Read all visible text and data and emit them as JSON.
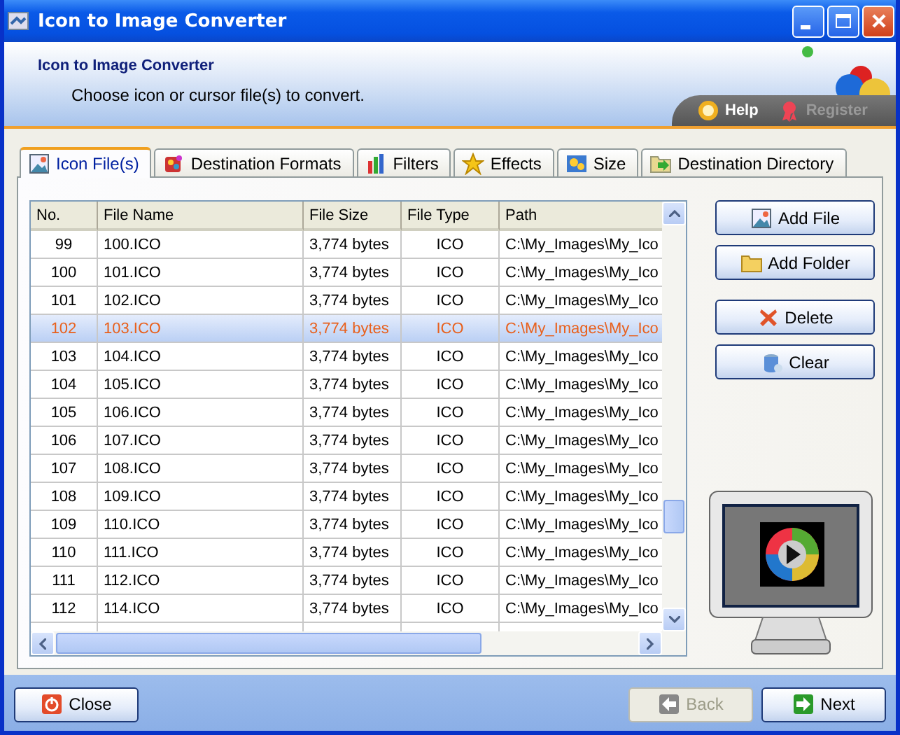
{
  "window": {
    "title": "Icon to Image Converter"
  },
  "header": {
    "title": "Icon to Image Converter",
    "subtitle": "Choose icon or cursor file(s) to convert.",
    "links": [
      {
        "label": "Help",
        "disabled": false
      },
      {
        "label": "Register",
        "disabled": true
      }
    ]
  },
  "tabs": [
    {
      "label": "Icon File(s)",
      "selected": true
    },
    {
      "label": "Destination Formats",
      "selected": false
    },
    {
      "label": "Filters",
      "selected": false
    },
    {
      "label": "Effects",
      "selected": false
    },
    {
      "label": "Size",
      "selected": false
    },
    {
      "label": "Destination Directory",
      "selected": false
    }
  ],
  "table": {
    "columns": [
      "No.",
      "File Name",
      "File Size",
      "File Type",
      "Path"
    ],
    "rows": [
      {
        "cells": [
          "99",
          "100.ICO",
          "3,774 bytes",
          "ICO",
          "C:\\My_Images\\My_Ico"
        ],
        "selected": false
      },
      {
        "cells": [
          "100",
          "101.ICO",
          "3,774 bytes",
          "ICO",
          "C:\\My_Images\\My_Ico"
        ],
        "selected": false
      },
      {
        "cells": [
          "101",
          "102.ICO",
          "3,774 bytes",
          "ICO",
          "C:\\My_Images\\My_Ico"
        ],
        "selected": false
      },
      {
        "cells": [
          "102",
          "103.ICO",
          "3,774 bytes",
          "ICO",
          "C:\\My_Images\\My_Ico"
        ],
        "selected": true
      },
      {
        "cells": [
          "103",
          "104.ICO",
          "3,774 bytes",
          "ICO",
          "C:\\My_Images\\My_Ico"
        ],
        "selected": false
      },
      {
        "cells": [
          "104",
          "105.ICO",
          "3,774 bytes",
          "ICO",
          "C:\\My_Images\\My_Ico"
        ],
        "selected": false
      },
      {
        "cells": [
          "105",
          "106.ICO",
          "3,774 bytes",
          "ICO",
          "C:\\My_Images\\My_Ico"
        ],
        "selected": false
      },
      {
        "cells": [
          "106",
          "107.ICO",
          "3,774 bytes",
          "ICO",
          "C:\\My_Images\\My_Ico"
        ],
        "selected": false
      },
      {
        "cells": [
          "107",
          "108.ICO",
          "3,774 bytes",
          "ICO",
          "C:\\My_Images\\My_Ico"
        ],
        "selected": false
      },
      {
        "cells": [
          "108",
          "109.ICO",
          "3,774 bytes",
          "ICO",
          "C:\\My_Images\\My_Ico"
        ],
        "selected": false
      },
      {
        "cells": [
          "109",
          "110.ICO",
          "3,774 bytes",
          "ICO",
          "C:\\My_Images\\My_Ico"
        ],
        "selected": false
      },
      {
        "cells": [
          "110",
          "111.ICO",
          "3,774 bytes",
          "ICO",
          "C:\\My_Images\\My_Ico"
        ],
        "selected": false
      },
      {
        "cells": [
          "111",
          "112.ICO",
          "3,774 bytes",
          "ICO",
          "C:\\My_Images\\My_Ico"
        ],
        "selected": false
      },
      {
        "cells": [
          "112",
          "114.ICO",
          "3,774 bytes",
          "ICO",
          "C:\\My_Images\\My_Ico"
        ],
        "selected": false
      }
    ]
  },
  "side_buttons": [
    {
      "label": "Add File",
      "kind": "file"
    },
    {
      "label": "Add Folder",
      "kind": "folder"
    },
    {
      "label": "Delete",
      "kind": "delete"
    },
    {
      "label": "Clear",
      "kind": "clear"
    }
  ],
  "footer_buttons": [
    {
      "label": "Close",
      "kind": "close",
      "disabled": false
    },
    {
      "label": "Back",
      "kind": "back",
      "disabled": true
    },
    {
      "label": "Next",
      "kind": "next",
      "disabled": false
    }
  ]
}
